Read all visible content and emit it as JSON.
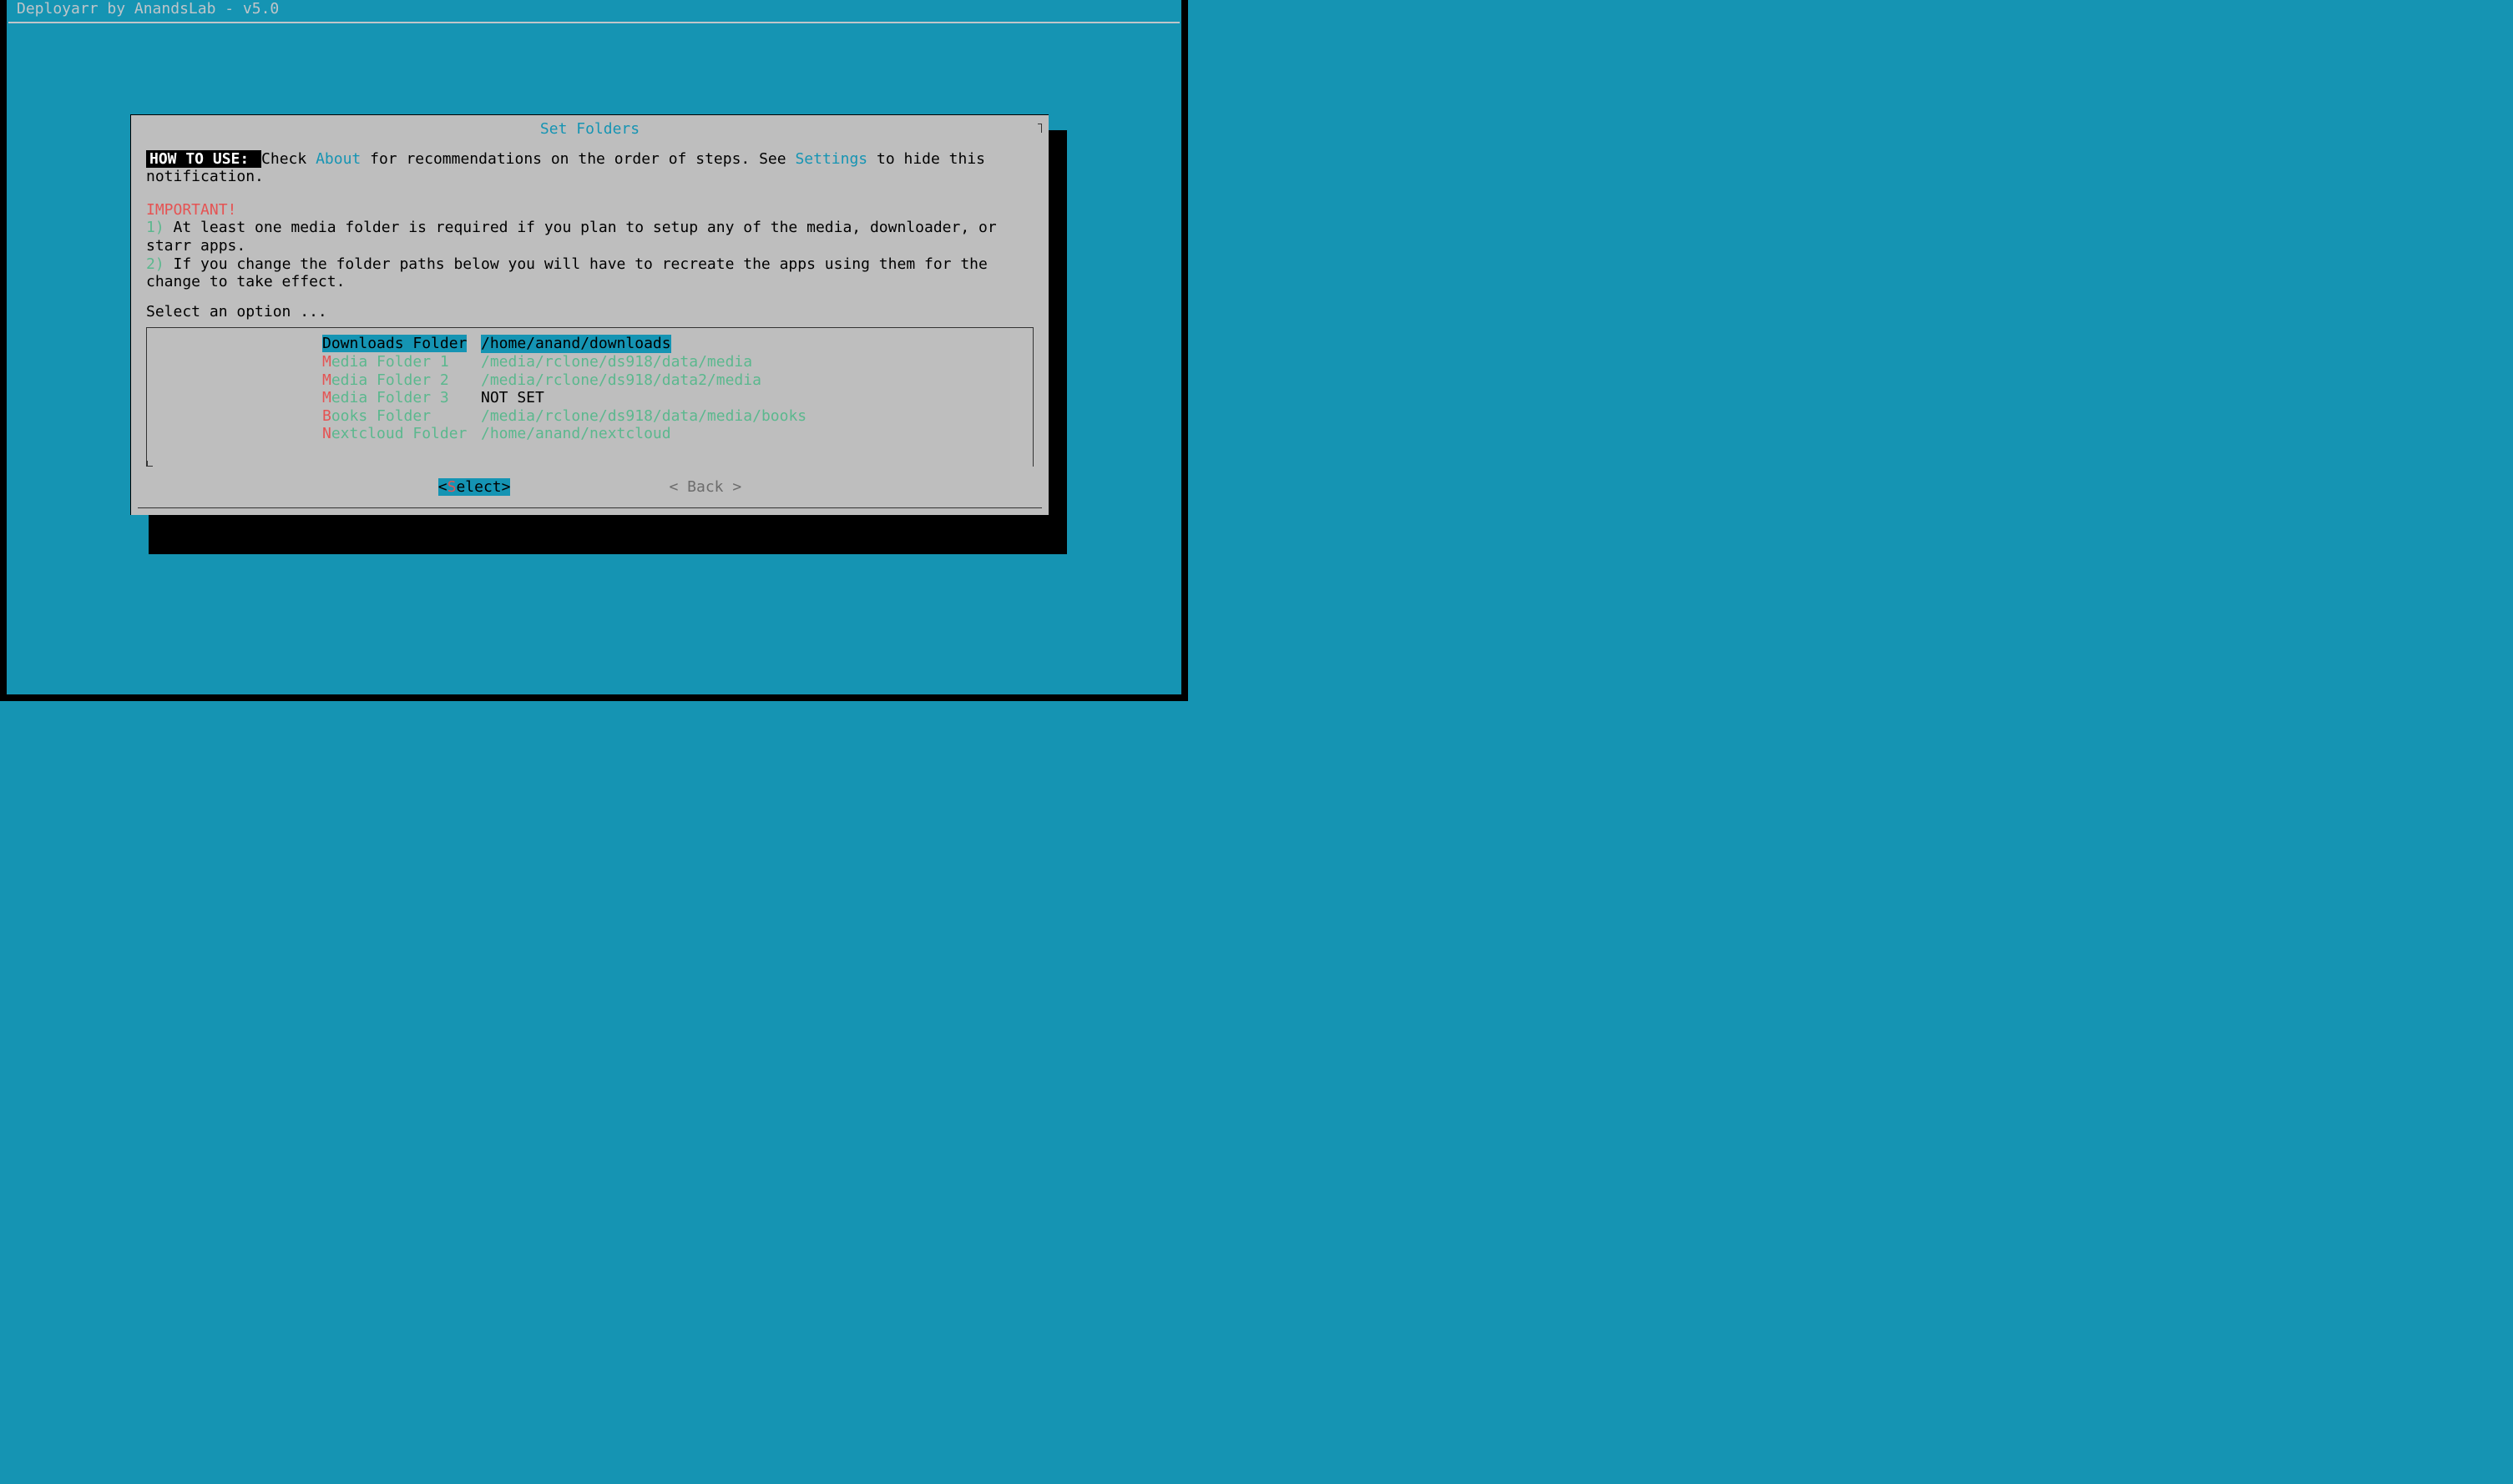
{
  "app_title": "Deployarr by AnandsLab - v5.0",
  "dialog": {
    "title": "Set Folders",
    "howto_label": " HOW TO USE: ",
    "howto_pre": " Check ",
    "howto_link1": "About",
    "howto_mid": " for recommendations on the order of steps. See ",
    "howto_link2": "Settings",
    "howto_post": " to hide this notification.",
    "important": "IMPORTANT!",
    "note1_num": "1)",
    "note1": " At least one media folder is required if you plan to setup any of the media, downloader, or starr apps.",
    "note2_num": "2)",
    "note2": " If you change the folder paths below you will have to recreate the apps using them for the change to take effect.",
    "prompt": "Select an option ..."
  },
  "menu": [
    {
      "hot": "D",
      "rest": "ownloads Folder",
      "value": "/home/anand/downloads",
      "selected": true,
      "notset": false
    },
    {
      "hot": "M",
      "rest": "edia Folder 1",
      "value": "/media/rclone/ds918/data/media",
      "selected": false,
      "notset": false
    },
    {
      "hot": "M",
      "rest": "edia Folder 2",
      "value": "/media/rclone/ds918/data2/media",
      "selected": false,
      "notset": false
    },
    {
      "hot": "M",
      "rest": "edia Folder 3",
      "value": "NOT SET",
      "selected": false,
      "notset": true
    },
    {
      "hot": "B",
      "rest": "ooks Folder",
      "value": "/media/rclone/ds918/data/media/books",
      "selected": false,
      "notset": false
    },
    {
      "hot": "N",
      "rest": "extcloud Folder",
      "value": "/home/anand/nextcloud",
      "selected": false,
      "notset": false
    }
  ],
  "buttons": {
    "select_hot": "S",
    "select_rest": "elect",
    "back": "Back"
  }
}
